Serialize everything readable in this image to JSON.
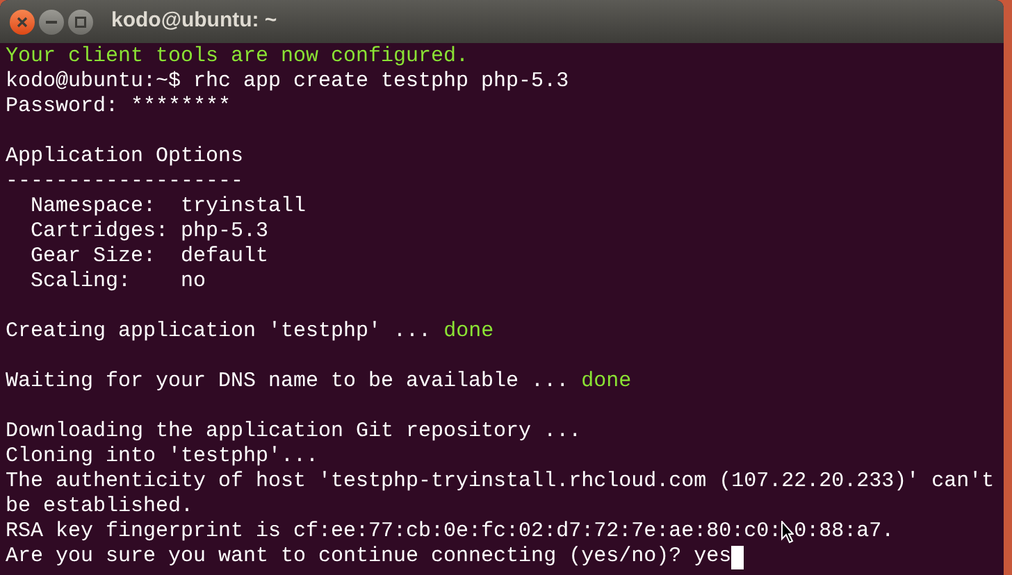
{
  "window": {
    "title": "kodo@ubuntu: ~"
  },
  "terminal": {
    "lines": [
      {
        "kind": "text",
        "spans": [
          {
            "kind": "success",
            "text": "Your client tools are now configured."
          }
        ]
      },
      {
        "kind": "text",
        "spans": [
          {
            "kind": "normal",
            "text": "kodo@ubuntu:~$ rhc app create testphp php-5.3"
          }
        ]
      },
      {
        "kind": "text",
        "spans": [
          {
            "kind": "normal",
            "text": "Password: ********"
          }
        ]
      },
      {
        "kind": "blank"
      },
      {
        "kind": "text",
        "spans": [
          {
            "kind": "normal",
            "text": "Application Options"
          }
        ]
      },
      {
        "kind": "text",
        "spans": [
          {
            "kind": "normal",
            "text": "-------------------"
          }
        ]
      },
      {
        "kind": "text",
        "spans": [
          {
            "kind": "normal",
            "text": "  Namespace:  tryinstall"
          }
        ]
      },
      {
        "kind": "text",
        "spans": [
          {
            "kind": "normal",
            "text": "  Cartridges: php-5.3"
          }
        ]
      },
      {
        "kind": "text",
        "spans": [
          {
            "kind": "normal",
            "text": "  Gear Size:  default"
          }
        ]
      },
      {
        "kind": "text",
        "spans": [
          {
            "kind": "normal",
            "text": "  Scaling:    no"
          }
        ]
      },
      {
        "kind": "blank"
      },
      {
        "kind": "text",
        "spans": [
          {
            "kind": "normal",
            "text": "Creating application 'testphp' ... "
          },
          {
            "kind": "success",
            "text": "done"
          }
        ]
      },
      {
        "kind": "blank"
      },
      {
        "kind": "text",
        "spans": [
          {
            "kind": "normal",
            "text": "Waiting for your DNS name to be available ... "
          },
          {
            "kind": "success",
            "text": "done"
          }
        ]
      },
      {
        "kind": "blank"
      },
      {
        "kind": "text",
        "spans": [
          {
            "kind": "normal",
            "text": "Downloading the application Git repository ..."
          }
        ]
      },
      {
        "kind": "text",
        "spans": [
          {
            "kind": "normal",
            "text": "Cloning into 'testphp'..."
          }
        ]
      },
      {
        "kind": "text",
        "spans": [
          {
            "kind": "normal",
            "text": "The authenticity of host 'testphp-tryinstall.rhcloud.com (107.22.20.233)' can't"
          }
        ]
      },
      {
        "kind": "text",
        "spans": [
          {
            "kind": "normal",
            "text": "be established."
          }
        ]
      },
      {
        "kind": "text",
        "spans": [
          {
            "kind": "normal",
            "text": "RSA key fingerprint is cf:ee:77:cb:0e:fc:02:d7:72:7e:ae:80:c0:"
          },
          {
            "kind": "pointer"
          },
          {
            "kind": "normal",
            "text": "0:88:a7."
          }
        ]
      },
      {
        "kind": "text",
        "cursor": true,
        "spans": [
          {
            "kind": "normal",
            "text": "Are you sure you want to continue connecting (yes/no)? yes"
          }
        ]
      }
    ]
  }
}
